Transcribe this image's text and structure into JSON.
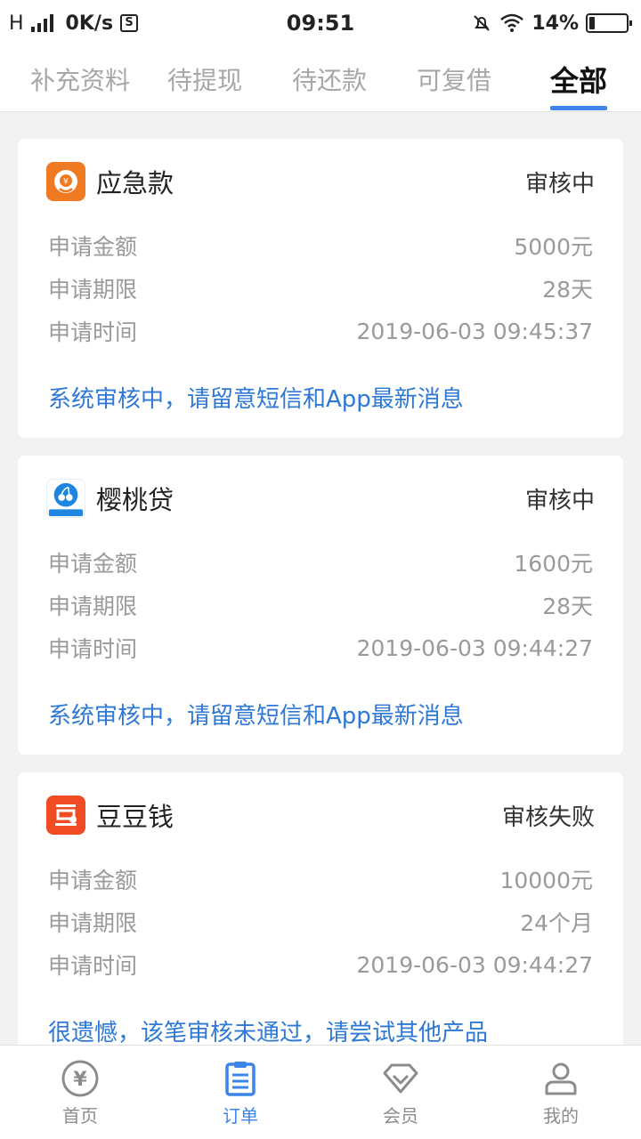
{
  "status_bar": {
    "network_type": "H",
    "speed": "0K/s",
    "box_glyph": "S",
    "time": "09:51",
    "battery": "14%",
    "battery_level": 0.14
  },
  "tabs": [
    {
      "label": "补充资料",
      "active": false
    },
    {
      "label": "待提现",
      "active": false
    },
    {
      "label": "待还款",
      "active": false
    },
    {
      "label": "可复借",
      "active": false
    },
    {
      "label": "全部",
      "active": true
    }
  ],
  "colors": {
    "accent": "#3d84e8",
    "link": "#2e78d6",
    "logo_orange": "#f07a22",
    "logo_blue": "#1e86e0",
    "logo_red": "#f04b22"
  },
  "orders": [
    {
      "logo_icon": "emergency-fund-logo",
      "name": "应急款",
      "status": "审核中",
      "rows": [
        {
          "label": "申请金额",
          "value": "5000元"
        },
        {
          "label": "申请期限",
          "value": "28天"
        },
        {
          "label": "申请时间",
          "value": "2019-06-03 09:45:37"
        }
      ],
      "message": "系统审核中，请留意短信和App最新消息"
    },
    {
      "logo_icon": "cherry-loan-logo",
      "name": "樱桃贷",
      "status": "审核中",
      "rows": [
        {
          "label": "申请金额",
          "value": "1600元"
        },
        {
          "label": "申请期限",
          "value": "28天"
        },
        {
          "label": "申请时间",
          "value": "2019-06-03 09:44:27"
        }
      ],
      "message": "系统审核中，请留意短信和App最新消息"
    },
    {
      "logo_icon": "doudou-money-logo",
      "name": "豆豆钱",
      "status": "审核失败",
      "rows": [
        {
          "label": "申请金额",
          "value": "10000元"
        },
        {
          "label": "申请期限",
          "value": "24个月"
        },
        {
          "label": "申请时间",
          "value": "2019-06-03 09:44:27"
        }
      ],
      "message": "很遗憾，该笔审核未通过，请尝试其他产品"
    }
  ],
  "bottom_nav": [
    {
      "label": "首页",
      "icon": "yuan-coin-icon",
      "active": false
    },
    {
      "label": "订单",
      "icon": "clipboard-list-icon",
      "active": true
    },
    {
      "label": "会员",
      "icon": "diamond-icon",
      "active": false
    },
    {
      "label": "我的",
      "icon": "user-icon",
      "active": false
    }
  ]
}
